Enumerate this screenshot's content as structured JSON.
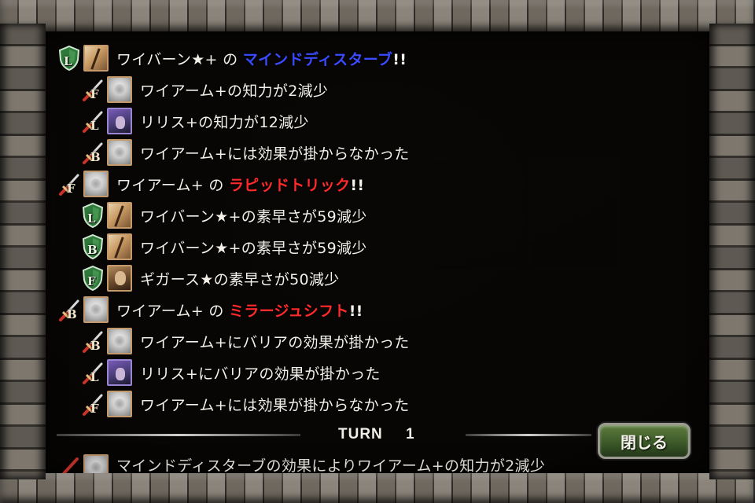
{
  "log": {
    "entries": [
      {
        "kind": "main",
        "side": "ally",
        "side_letter": "L",
        "portrait": "wyvern",
        "actor": "ワイバーン★+ の ",
        "skill": "マインドディスターブ",
        "skill_color": "blue",
        "suffix": "!!"
      },
      {
        "kind": "sub",
        "side": "enemy",
        "side_letter": "F",
        "portrait": "wyarm",
        "text": "ワイアーム+の知力が2減少"
      },
      {
        "kind": "sub",
        "side": "enemy",
        "side_letter": "L",
        "portrait": "lilith",
        "text": "リリス+の知力が12減少"
      },
      {
        "kind": "sub",
        "side": "enemy",
        "side_letter": "B",
        "portrait": "wyarm",
        "text": "ワイアーム+には効果が掛からなかった"
      },
      {
        "kind": "main",
        "side": "enemy",
        "side_letter": "F",
        "portrait": "wyarm",
        "actor": "ワイアーム+ の ",
        "skill": "ラピッドトリック",
        "skill_color": "red",
        "suffix": "!!"
      },
      {
        "kind": "sub",
        "side": "ally",
        "side_letter": "L",
        "portrait": "wyvern",
        "text": "ワイバーン★+の素早さが59減少"
      },
      {
        "kind": "sub",
        "side": "ally",
        "side_letter": "B",
        "portrait": "wyvern",
        "text": "ワイバーン★+の素早さが59減少"
      },
      {
        "kind": "sub",
        "side": "ally",
        "side_letter": "F",
        "portrait": "gigars",
        "text": "ギガース★の素早さが50減少"
      },
      {
        "kind": "main",
        "side": "enemy",
        "side_letter": "B",
        "portrait": "wyarm",
        "actor": "ワイアーム+ の ",
        "skill": "ミラージュシフト",
        "skill_color": "red",
        "suffix": "!!"
      },
      {
        "kind": "sub",
        "side": "enemy",
        "side_letter": "B",
        "portrait": "wyarm",
        "text": "ワイアーム+にバリアの効果が掛かった"
      },
      {
        "kind": "sub",
        "side": "enemy",
        "side_letter": "L",
        "portrait": "lilith",
        "text": "リリス+にバリアの効果が掛かった"
      },
      {
        "kind": "sub",
        "side": "enemy",
        "side_letter": "F",
        "portrait": "wyarm",
        "text": "ワイアーム+には効果が掛からなかった"
      }
    ],
    "peek_text": "マインドディスターブの効果によりワイアーム+の知力が2減少"
  },
  "turn": {
    "label": "TURN",
    "number": "1"
  },
  "close_button": {
    "label": "閉じる"
  },
  "colors": {
    "ally_shield": "#2f7a3a",
    "enemy_sword": "#c8322a",
    "skill_blue": "#3a4bff",
    "skill_red": "#ff2a2a",
    "button_green": "#3c5a28"
  }
}
